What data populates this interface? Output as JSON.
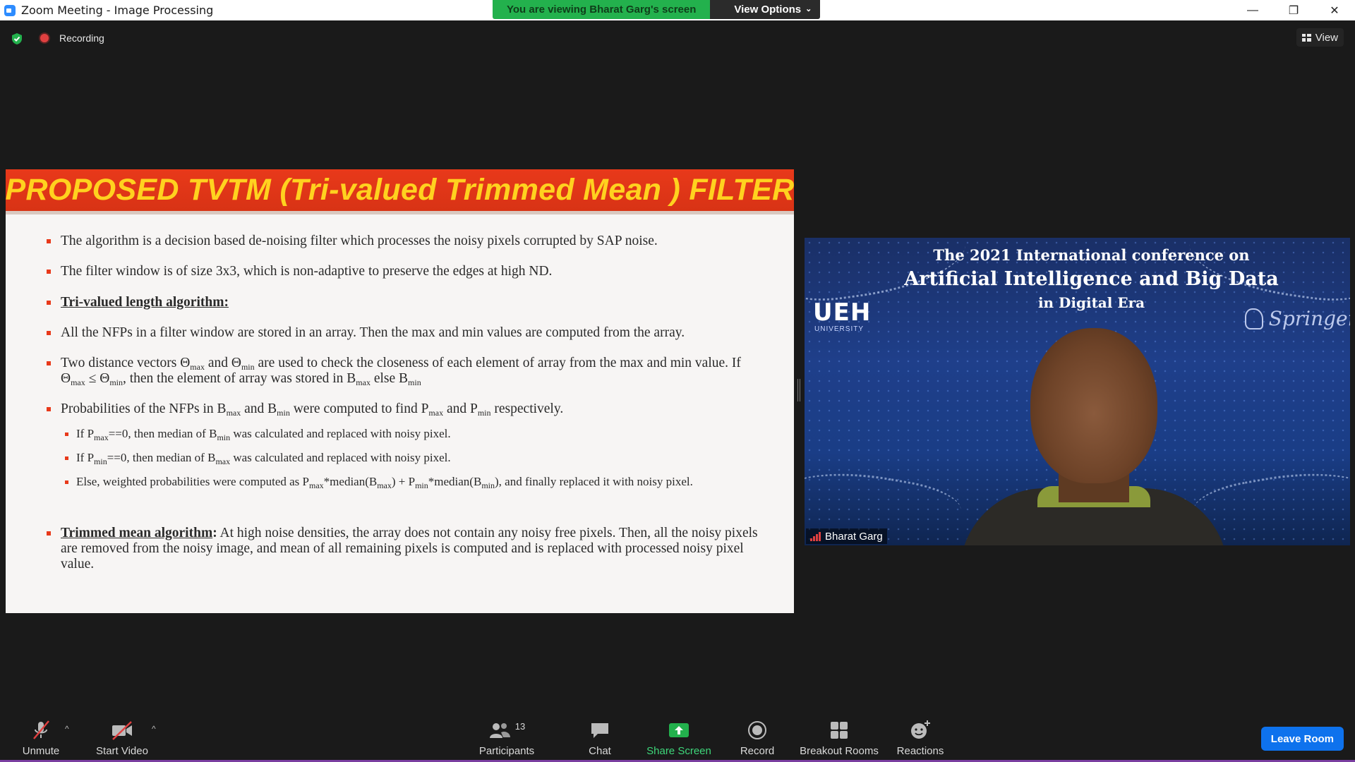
{
  "window": {
    "title": "Zoom Meeting - Image Processing",
    "controls": [
      "minimize",
      "restore",
      "close"
    ]
  },
  "share_banner": {
    "viewing_text": "You are viewing Bharat Garg's screen",
    "view_options_label": "View Options"
  },
  "status": {
    "recording_label": "Recording",
    "view_label": "View"
  },
  "slide": {
    "title": "PROPOSED TVTM (Tri-valued Trimmed Mean ) FILTER",
    "b1": "The algorithm is a decision based de-noising filter which processes the noisy pixels corrupted by SAP noise.",
    "b2": "The filter window is of size 3x3, which is non-adaptive to preserve the edges at high ND.",
    "b3": "Tri-valued length algorithm:",
    "b4": "All the NFPs in a filter window are stored in an array. Then the max and min values are computed from the array.",
    "b5": {
      "t1": "Two distance vectors Θ",
      "s1": "max",
      "t2": " and Θ",
      "s2": "min",
      "t3": " are used to check the closeness of each element of array from the max and min value. If Θ",
      "s3": "max",
      "t4": " ≤ Θ",
      "s4": "min",
      "t5": ", then the element of array was stored in B",
      "s5": "max",
      "t6": " else B",
      "s6": "min"
    },
    "b6": {
      "t1": "Probabilities of the NFPs in B",
      "s1": "max",
      "t2": " and B",
      "s2": "min",
      "t3": " were computed to find P",
      "s3": "max",
      "t4": " and P",
      "s4": "min",
      "t5": " respectively."
    },
    "sub1": {
      "t1": "If P",
      "s1": "max",
      "t2": "==0, then median of B",
      "s2": "min",
      "t3": " was calculated and replaced with noisy pixel."
    },
    "sub2": {
      "t1": "If P",
      "s1": "min",
      "t2": "==0, then median of B",
      "s2": "max",
      "t3": " was calculated and replaced with noisy pixel."
    },
    "sub3": {
      "t1": "Else, weighted probabilities were computed as P",
      "s1": "max",
      "t2": "*median(B",
      "s2": "max",
      "t3": ") + P",
      "s3": "min",
      "t4": "*median(B",
      "s4": "min",
      "t5": "), and finally replaced it with noisy pixel."
    },
    "b7_head": "Trimmed mean algorithm",
    "b7_colon": ":",
    "b7_text": " At high noise densities, the array does not contain any noisy free pixels. Then, all the noisy pixels are removed from the noisy image, and mean of all remaining pixels is computed and is replaced with processed noisy pixel value."
  },
  "video": {
    "banner_line1": "The 2021 International conference on",
    "banner_line2": "Artificial Intelligence and Big Data",
    "banner_line3": "in Digital Era",
    "logo_left": "UEH",
    "logo_left_sub": "UNIVERSITY",
    "logo_right": "Springer",
    "participant_name": "Bharat Garg"
  },
  "toolbar": {
    "unmute": "Unmute",
    "start_video": "Start Video",
    "participants": "Participants",
    "participants_count": "13",
    "chat": "Chat",
    "share_screen": "Share Screen",
    "record": "Record",
    "breakout_rooms": "Breakout Rooms",
    "reactions": "Reactions",
    "leave_room": "Leave Room"
  },
  "colors": {
    "slide_header": "#e8391a",
    "slide_title": "#ffd21f",
    "share_green": "#23b14d",
    "leave_blue": "#0e72ed",
    "muted_red": "#e04040"
  }
}
